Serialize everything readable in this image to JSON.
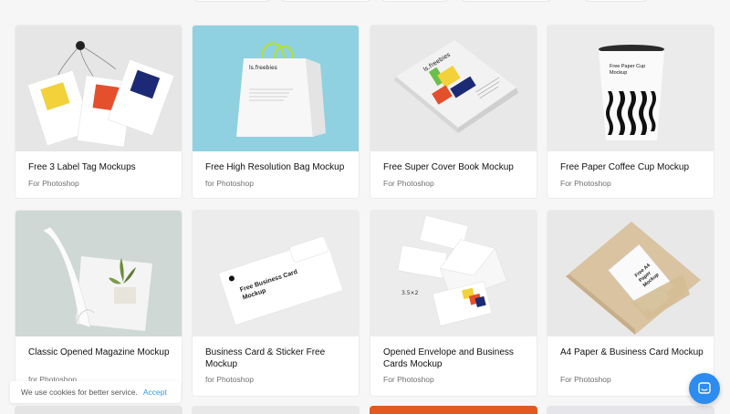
{
  "cards": [
    {
      "title": "Free 3 Label Tag Mockups",
      "sub": "For Photoshop"
    },
    {
      "title": "Free High Resolution Bag Mockup",
      "sub": "for Photoshop"
    },
    {
      "title": "Free Super Cover Book Mockup",
      "sub": "For Photoshop"
    },
    {
      "title": "Free Paper Coffee Cup Mockup",
      "sub": "For Photoshop"
    },
    {
      "title": "Classic Opened Magazine Mockup",
      "sub": "for Photoshop"
    },
    {
      "title": "Business Card & Sticker Free Mockup",
      "sub": "for Photoshop"
    },
    {
      "title": "Opened Envelope and Business Cards Mockup",
      "sub": "For Photoshop"
    },
    {
      "title": "A4 Paper & Business Card Mockup",
      "sub": "For Photoshop"
    }
  ],
  "thumbs": {
    "bag_brand": "ls.freebies",
    "book_brand": "ls.freebies",
    "cup_text": "Free Paper Cup Mockup",
    "bizcard_text": "Free Business Card Mockup",
    "a4_text": "Free A4 Paper Mockup"
  },
  "cookie": {
    "message": "We use cookies for better service.",
    "accept": "Accept"
  },
  "icons": {
    "chat": "chat-bubble-icon"
  },
  "colors": {
    "accent": "#2b9cf2",
    "chat_button": "#2d8cf0",
    "bag_bg": "#8fd1e0",
    "orange": "#e3591f"
  }
}
